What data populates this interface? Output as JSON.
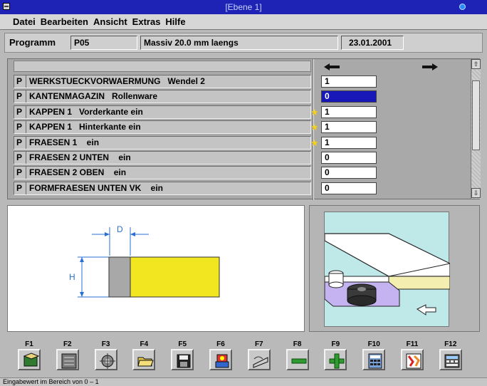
{
  "window": {
    "title": "[Ebene 1]"
  },
  "menu": [
    "Datei",
    "Bearbeiten",
    "Ansicht",
    "Extras",
    "Hilfe"
  ],
  "program": {
    "label": "Programm",
    "code": "P05",
    "description": "Massiv 20.0 mm laengs",
    "date": "23.01.2001"
  },
  "operations": [
    {
      "tag": "P",
      "name": "WERKSTUECKVORWAERMUNG   Wendel 2",
      "value": "1",
      "starred": false,
      "selected": false
    },
    {
      "tag": "P",
      "name": "KANTENMAGAZIN   Rollenware",
      "value": "0",
      "starred": false,
      "selected": true
    },
    {
      "tag": "P",
      "name": "KAPPEN 1   Vorderkante ein",
      "value": "1",
      "starred": true,
      "selected": false
    },
    {
      "tag": "P",
      "name": "KAPPEN 1   Hinterkante ein",
      "value": "1",
      "starred": true,
      "selected": false
    },
    {
      "tag": "P",
      "name": "FRAESEN 1    ein",
      "value": "1",
      "starred": true,
      "selected": false
    },
    {
      "tag": "P",
      "name": "FRAESEN 2 UNTEN    ein",
      "value": "0",
      "starred": false,
      "selected": false
    },
    {
      "tag": "P",
      "name": "FRAESEN 2 OBEN    ein",
      "value": "0",
      "starred": false,
      "selected": false
    },
    {
      "tag": "P",
      "name": "FORMFRAESEN UNTEN VK    ein",
      "value": "0",
      "starred": false,
      "selected": false
    }
  ],
  "drawing": {
    "dim_d": "D",
    "dim_h": "H"
  },
  "fkeys": [
    "F1",
    "F2",
    "F3",
    "F4",
    "F5",
    "F6",
    "F7",
    "F8",
    "F9",
    "F10",
    "F11",
    "F12"
  ],
  "fkey_icons": [
    "book-icon",
    "machine-icon",
    "gear-icon",
    "folder-open-icon",
    "save-icon",
    "tools-icon",
    "edge-icon",
    "minus-icon",
    "plus-icon",
    "calculator-icon",
    "warning-icon",
    "keyboard-icon"
  ],
  "status": "Eingabewert im Bereich von 0 – 1",
  "colors": {
    "title": "#1e22b5",
    "selection": "#1818b8",
    "edge": "#f5e62a",
    "star": "#f5d21a"
  }
}
